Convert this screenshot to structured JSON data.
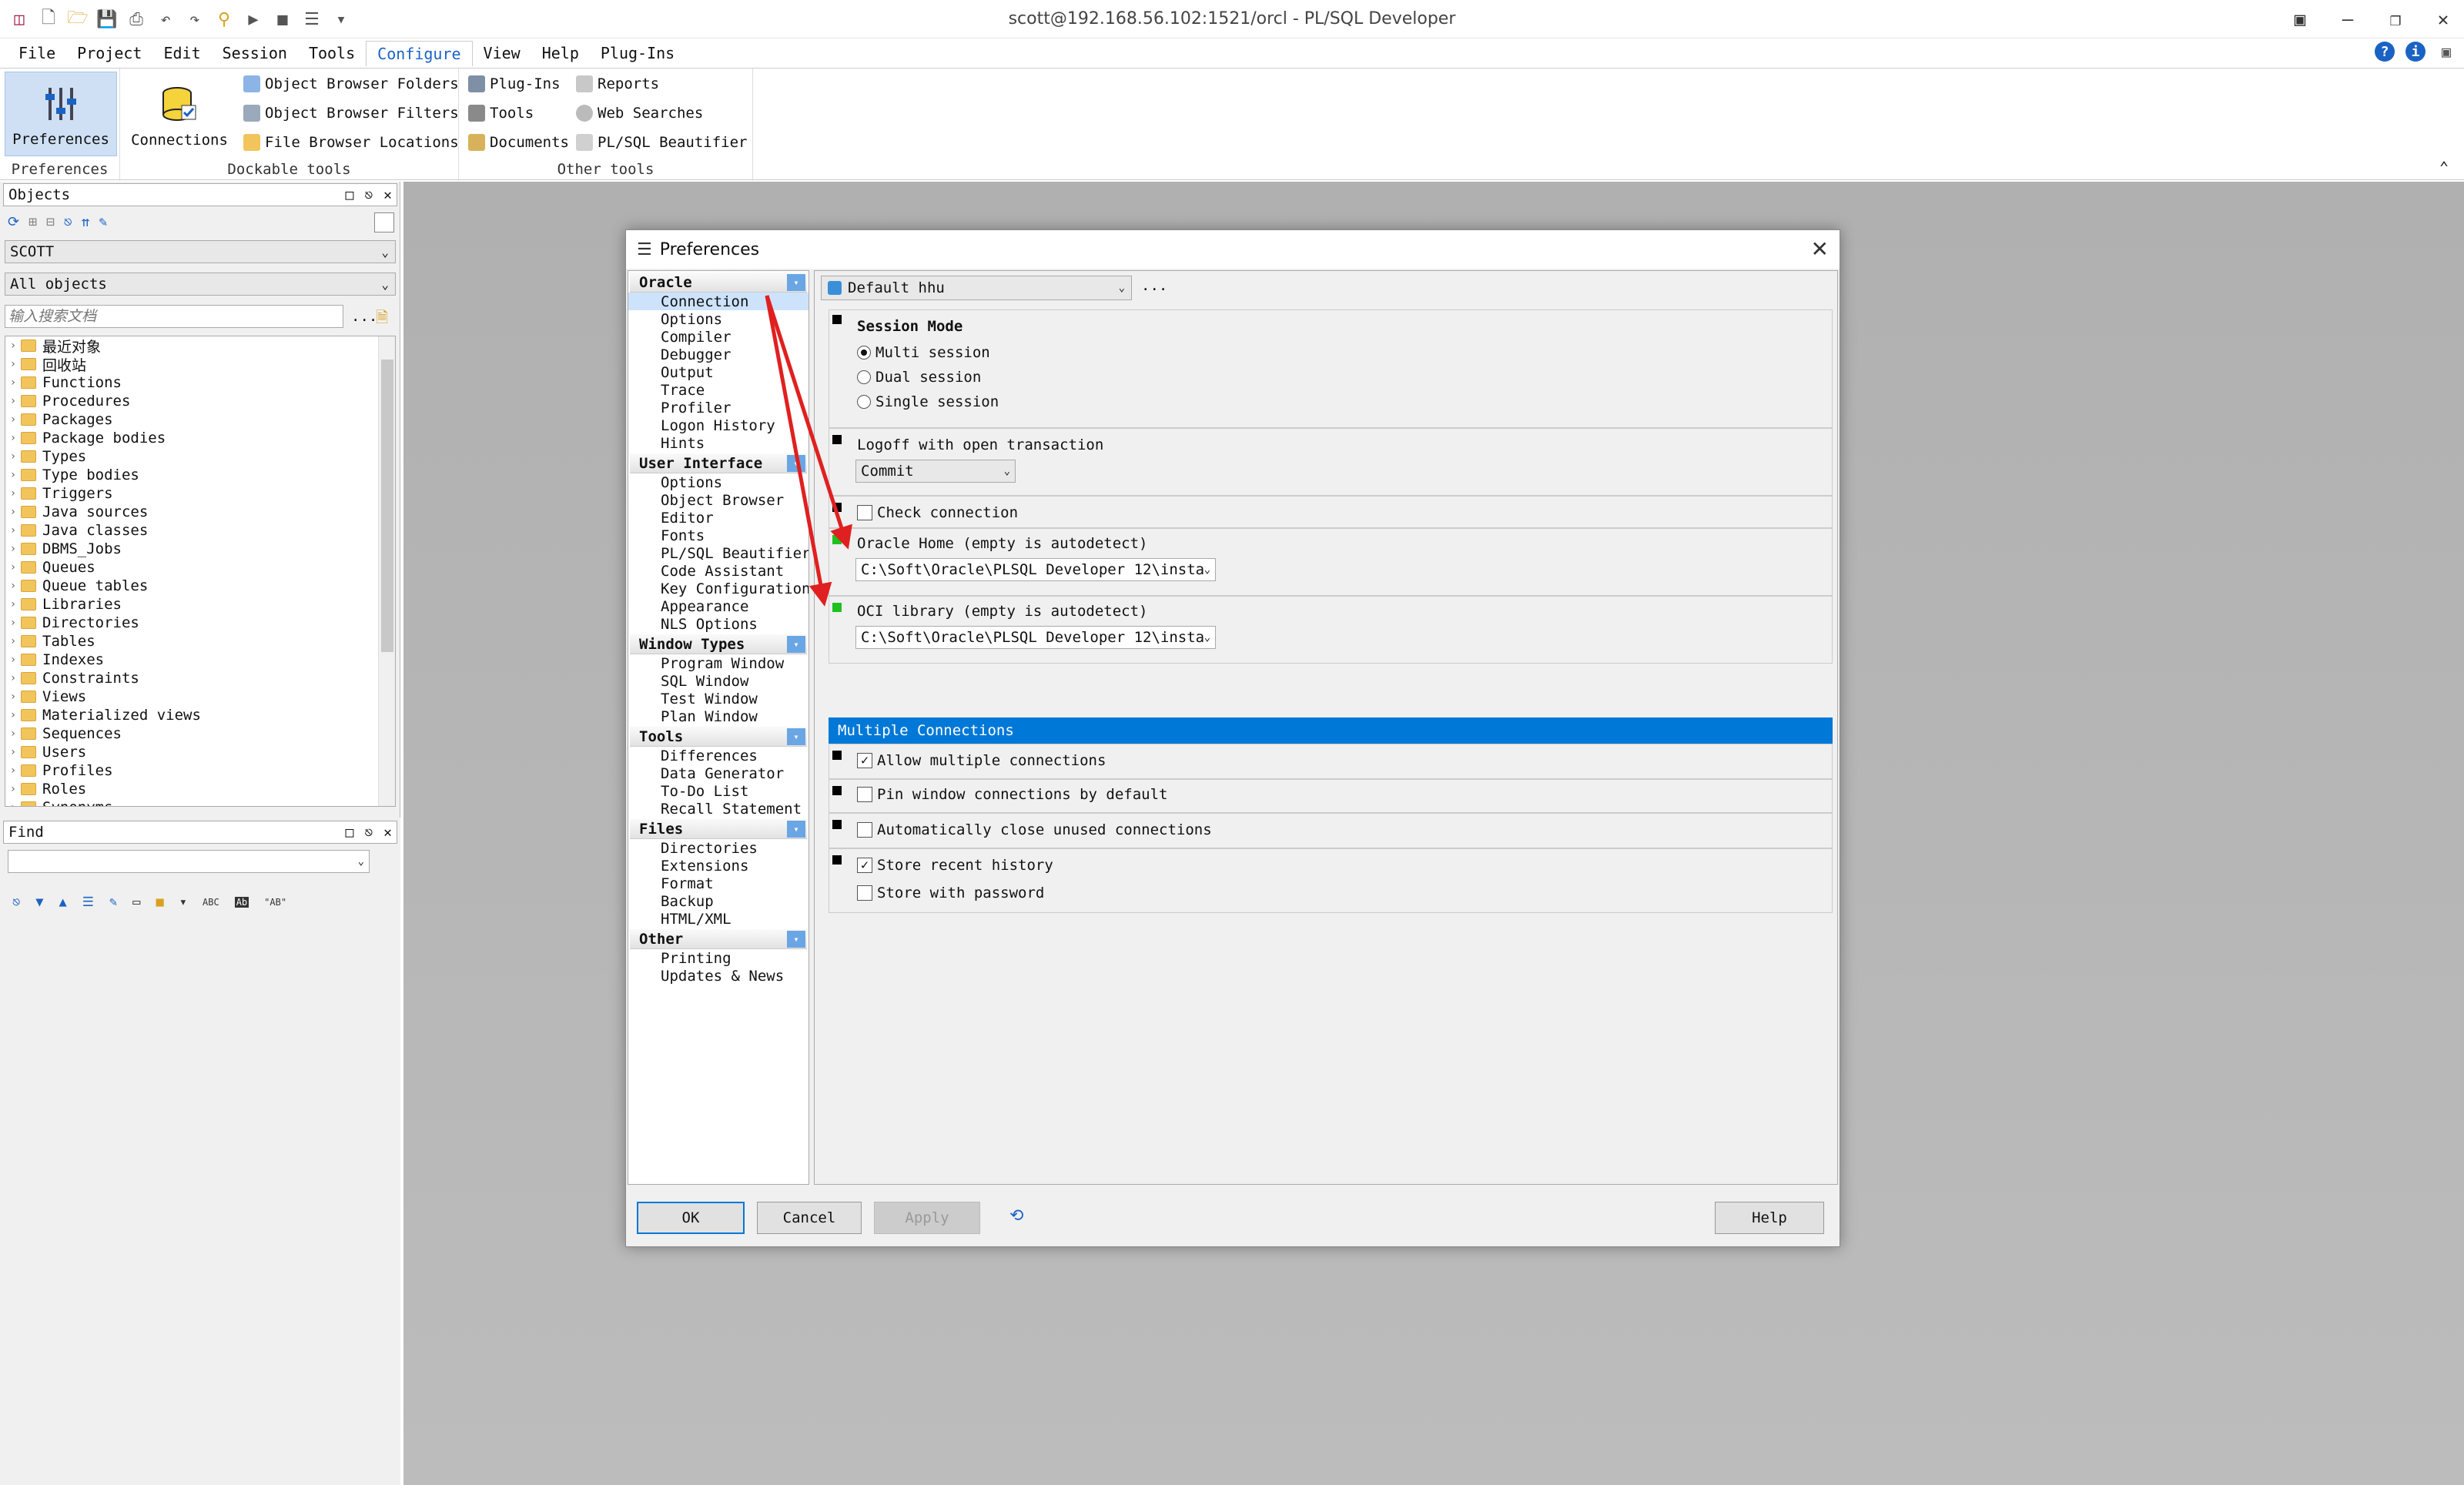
{
  "window": {
    "title": "scott@192.168.56.102:1521/orcl - PL/SQL Developer"
  },
  "menu": [
    "File",
    "Project",
    "Edit",
    "Session",
    "Tools",
    "Configure",
    "View",
    "Help",
    "Plug-Ins"
  ],
  "ribbon": {
    "preferences_btn": "Preferences",
    "connections_btn": "Connections",
    "object_browser_folders": "Object Browser Folders",
    "object_browser_filters": "Object Browser Filters",
    "file_browser_locations": "File Browser Locations",
    "plugins": "Plug-Ins",
    "tools": "Tools",
    "documents": "Documents",
    "reports": "Reports",
    "web_searches": "Web Searches",
    "plsql_beautifier": "PL/SQL Beautifier",
    "group_preferences": "Preferences",
    "group_dockable": "Dockable tools",
    "group_other": "Other tools"
  },
  "objects_panel": {
    "title": "Objects",
    "user": "SCOTT",
    "filter": "All objects",
    "search_placeholder": "输入搜索文档",
    "search_more": "...",
    "tree": [
      "最近对象",
      "回收站",
      "Functions",
      "Procedures",
      "Packages",
      "Package bodies",
      "Types",
      "Type bodies",
      "Triggers",
      "Java sources",
      "Java classes",
      "DBMS_Jobs",
      "Queues",
      "Queue tables",
      "Libraries",
      "Directories",
      "Tables",
      "Indexes",
      "Constraints",
      "Views",
      "Materialized views",
      "Sequences",
      "Users",
      "Profiles",
      "Roles",
      "Synonyms"
    ]
  },
  "find_panel": {
    "title": "Find",
    "value": ""
  },
  "dialog": {
    "title": "Preferences",
    "nav": [
      {
        "header": "Oracle",
        "items": [
          "Connection",
          "Options",
          "Compiler",
          "Debugger",
          "Output",
          "Trace",
          "Profiler",
          "Logon History",
          "Hints"
        ]
      },
      {
        "header": "User Interface",
        "items": [
          "Options",
          "Object Browser",
          "Editor",
          "Fonts",
          "PL/SQL Beautifier",
          "Code Assistant",
          "Key Configuration",
          "Appearance",
          "NLS Options"
        ]
      },
      {
        "header": "Window Types",
        "items": [
          "Program Window",
          "SQL Window",
          "Test Window",
          "Plan Window"
        ]
      },
      {
        "header": "Tools",
        "items": [
          "Differences",
          "Data Generator",
          "To-Do List",
          "Recall Statement"
        ]
      },
      {
        "header": "Files",
        "items": [
          "Directories",
          "Extensions",
          "Format",
          "Backup",
          "HTML/XML"
        ]
      },
      {
        "header": "Other",
        "items": [
          "Printing",
          "Updates & News"
        ]
      }
    ],
    "profile": "Default hhu",
    "profile_more": "...",
    "session_mode": {
      "label": "Session Mode",
      "options": [
        "Multi session",
        "Dual session",
        "Single session"
      ],
      "selected": "Multi session"
    },
    "logoff": {
      "label": "Logoff with open transaction",
      "value": "Commit"
    },
    "check_connection": {
      "label": "Check connection",
      "checked": false
    },
    "oracle_home": {
      "label": "Oracle Home (empty is autodetect)",
      "value": "C:\\Soft\\Oracle\\PLSQL Developer 12\\insta"
    },
    "oci_library": {
      "label": "OCI library (empty is autodetect)",
      "value": "C:\\Soft\\Oracle\\PLSQL Developer 12\\insta"
    },
    "multiple_connections": {
      "header": "Multiple Connections",
      "allow": {
        "label": "Allow multiple connections",
        "checked": true
      },
      "pin": {
        "label": "Pin window connections by default",
        "checked": false
      },
      "auto_close": {
        "label": "Automatically close unused connections",
        "checked": false
      },
      "store_history": {
        "label": "Store recent history",
        "checked": true
      },
      "store_password": {
        "label": "Store with password",
        "checked": false
      }
    },
    "buttons": {
      "ok": "OK",
      "cancel": "Cancel",
      "apply": "Apply",
      "help": "Help"
    }
  },
  "colors": {
    "accent": "#0078d7",
    "selection": "#cde3fb",
    "arrow": "#e02020",
    "green_marker": "#1ec21e"
  }
}
